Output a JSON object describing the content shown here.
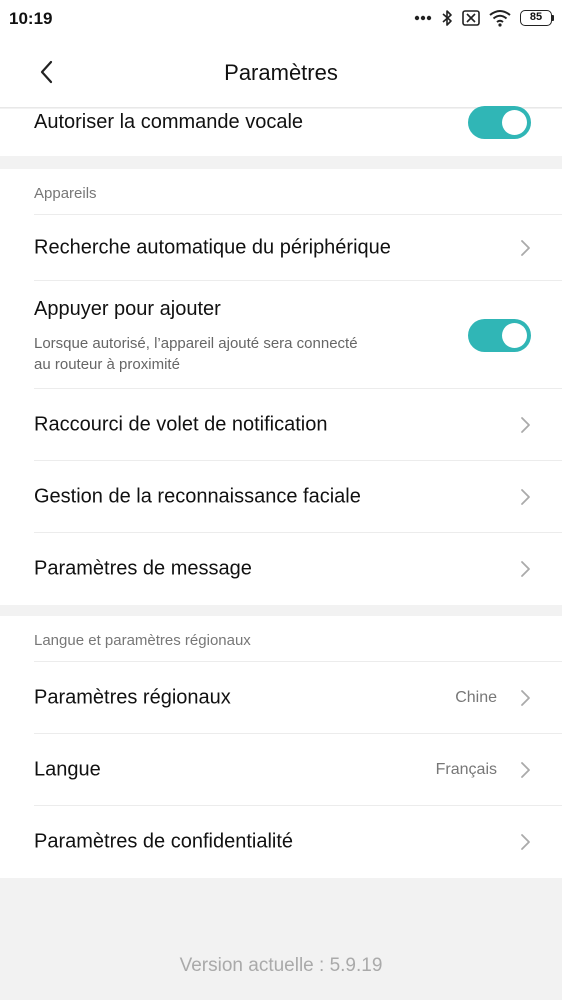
{
  "status_bar": {
    "time": "10:19",
    "battery": "85",
    "icons": [
      "more-icon",
      "bluetooth-icon",
      "no-sim-icon",
      "wifi-icon",
      "battery-icon"
    ]
  },
  "header": {
    "title": "Paramètres"
  },
  "top_section": {
    "voice_command_label": "Autoriser la commande vocale",
    "voice_command_enabled": true
  },
  "devices_section": {
    "header": "Appareils",
    "auto_search_label": "Recherche automatique du périphérique",
    "tap_to_add_title": "Appuyer pour ajouter",
    "tap_to_add_desc": "Lorsque autorisé, l’appareil ajouté sera connecté au routeur à proximité",
    "tap_to_add_enabled": true,
    "notification_shortcut_label": "Raccourci de volet de notification",
    "face_recognition_label": "Gestion de la reconnaissance faciale",
    "message_settings_label": "Paramètres de message"
  },
  "language_section": {
    "header": "Langue et paramètres régionaux",
    "regional_label": "Paramètres régionaux",
    "regional_value": "Chine",
    "language_label": "Langue",
    "language_value": "Français",
    "privacy_label": "Paramètres de confidentialité"
  },
  "footer": {
    "version": "Version actuelle : 5.9.19"
  },
  "colors": {
    "toggle_on": "#30b6b6",
    "background": "#f2f2f2"
  }
}
